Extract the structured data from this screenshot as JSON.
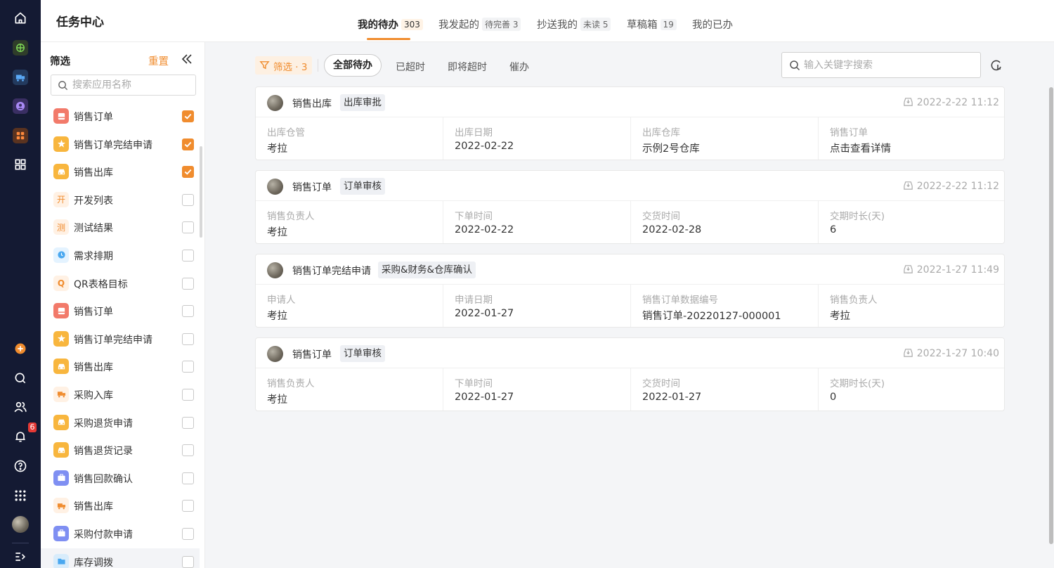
{
  "header": {
    "title": "任务中心",
    "tabs": [
      {
        "label": "我的待办",
        "count": "303"
      },
      {
        "label": "我发起的",
        "count": "待完善 3"
      },
      {
        "label": "抄送我的",
        "count": "未读 5"
      },
      {
        "label": "草稿箱",
        "count": "19"
      },
      {
        "label": "我的已办",
        "count": ""
      }
    ]
  },
  "rail": {
    "notification_count": "6",
    "colors": {
      "bg": "#141a33",
      "accent": "#f08c2e"
    }
  },
  "filter": {
    "title": "筛选",
    "reset_label": "重置",
    "search_placeholder": "搜索应用名称",
    "apps": [
      {
        "name": "销售订单",
        "checked": true
      },
      {
        "name": "销售订单完结申请",
        "checked": true
      },
      {
        "name": "销售出库",
        "checked": true
      },
      {
        "name": "开发列表",
        "checked": false,
        "glyph": "开"
      },
      {
        "name": "测试结果",
        "checked": false,
        "glyph": "测"
      },
      {
        "name": "需求排期",
        "checked": false
      },
      {
        "name": "QR表格目标",
        "checked": false,
        "glyph": "Q"
      },
      {
        "name": "销售订单",
        "checked": false
      },
      {
        "name": "销售订单完结申请",
        "checked": false
      },
      {
        "name": "销售出库",
        "checked": false
      },
      {
        "name": "采购入库",
        "checked": false
      },
      {
        "name": "采购退货申请",
        "checked": false
      },
      {
        "name": "销售退货记录",
        "checked": false
      },
      {
        "name": "销售回款确认",
        "checked": false
      },
      {
        "name": "销售出库",
        "checked": false
      },
      {
        "name": "采购付款申请",
        "checked": false
      },
      {
        "name": "库存调拨",
        "checked": false
      }
    ]
  },
  "toolbar": {
    "filter_label": "筛选 · 3",
    "segments": [
      "全部待办",
      "已超时",
      "即将超时",
      "催办"
    ],
    "search_placeholder": "输入关键字搜索"
  },
  "cards": [
    {
      "app": "销售出库",
      "tag": "出库审批",
      "time": "2022-2-22 11:12",
      "fields": [
        {
          "label": "出库仓管",
          "value": "考拉"
        },
        {
          "label": "出库日期",
          "value": "2022-02-22"
        },
        {
          "label": "出库仓库",
          "value": "示例2号仓库"
        },
        {
          "label": "销售订单",
          "value": "点击查看详情"
        }
      ]
    },
    {
      "app": "销售订单",
      "tag": "订单审核",
      "time": "2022-2-22 11:12",
      "fields": [
        {
          "label": "销售负责人",
          "value": "考拉"
        },
        {
          "label": "下单时间",
          "value": "2022-02-22"
        },
        {
          "label": "交货时间",
          "value": "2022-02-28"
        },
        {
          "label": "交期时长(天)",
          "value": "6"
        }
      ]
    },
    {
      "app": "销售订单完结申请",
      "tag": "采购&财务&仓库确认",
      "time": "2022-1-27 11:49",
      "fields": [
        {
          "label": "申请人",
          "value": "考拉"
        },
        {
          "label": "申请日期",
          "value": "2022-01-27"
        },
        {
          "label": "销售订单数据编号",
          "value": "销售订单-20220127-000001"
        },
        {
          "label": "销售负责人",
          "value": "考拉"
        }
      ]
    },
    {
      "app": "销售订单",
      "tag": "订单审核",
      "time": "2022-1-27 10:40",
      "fields": [
        {
          "label": "销售负责人",
          "value": "考拉"
        },
        {
          "label": "下单时间",
          "value": "2022-01-27"
        },
        {
          "label": "交货时间",
          "value": "2022-01-27"
        },
        {
          "label": "交期时长(天)",
          "value": "0"
        }
      ]
    }
  ]
}
